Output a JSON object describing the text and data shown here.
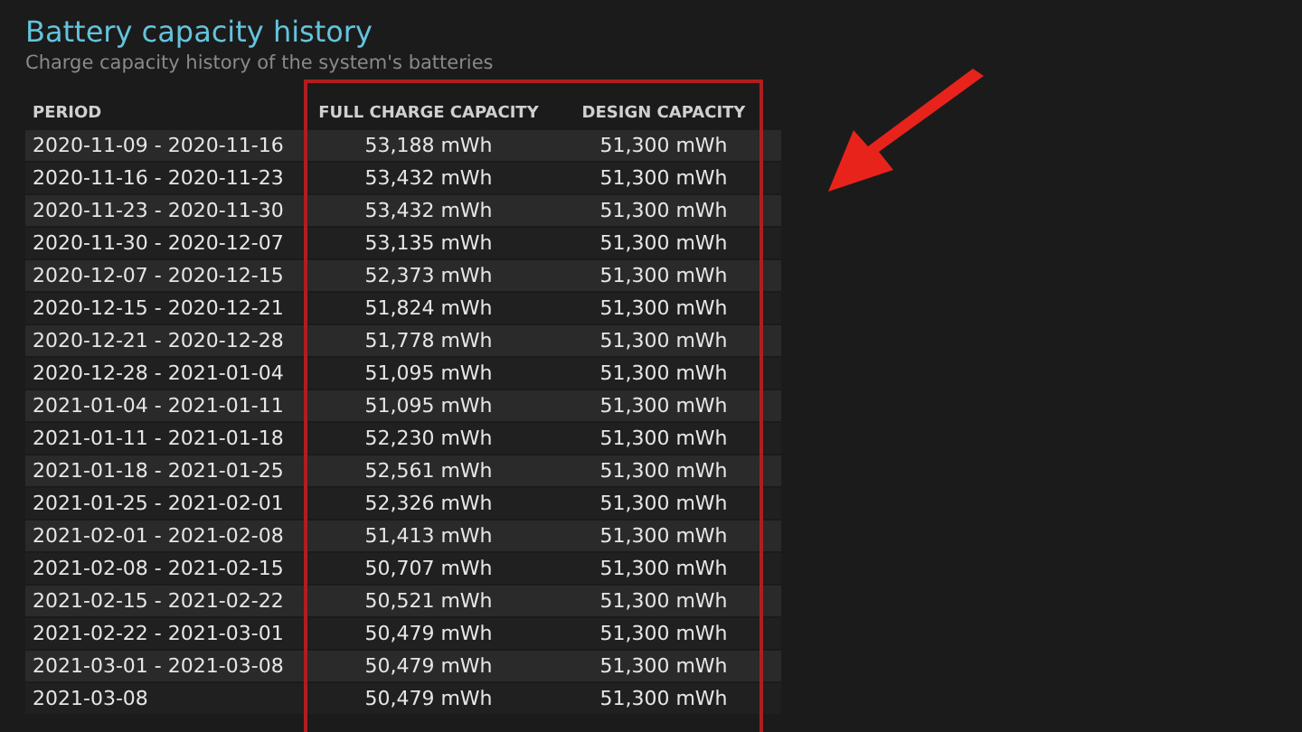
{
  "title": "Battery capacity history",
  "subtitle": "Charge capacity history of the system's batteries",
  "table": {
    "columns": [
      "PERIOD",
      "FULL CHARGE CAPACITY",
      "DESIGN CAPACITY"
    ],
    "rows": [
      [
        "2020-11-09 - 2020-11-16",
        "53,188 mWh",
        "51,300 mWh"
      ],
      [
        "2020-11-16 - 2020-11-23",
        "53,432 mWh",
        "51,300 mWh"
      ],
      [
        "2020-11-23 - 2020-11-30",
        "53,432 mWh",
        "51,300 mWh"
      ],
      [
        "2020-11-30 - 2020-12-07",
        "53,135 mWh",
        "51,300 mWh"
      ],
      [
        "2020-12-07 - 2020-12-15",
        "52,373 mWh",
        "51,300 mWh"
      ],
      [
        "2020-12-15 - 2020-12-21",
        "51,824 mWh",
        "51,300 mWh"
      ],
      [
        "2020-12-21 - 2020-12-28",
        "51,778 mWh",
        "51,300 mWh"
      ],
      [
        "2020-12-28 - 2021-01-04",
        "51,095 mWh",
        "51,300 mWh"
      ],
      [
        "2021-01-04 - 2021-01-11",
        "51,095 mWh",
        "51,300 mWh"
      ],
      [
        "2021-01-11 - 2021-01-18",
        "52,230 mWh",
        "51,300 mWh"
      ],
      [
        "2021-01-18 - 2021-01-25",
        "52,561 mWh",
        "51,300 mWh"
      ],
      [
        "2021-01-25 - 2021-02-01",
        "52,326 mWh",
        "51,300 mWh"
      ],
      [
        "2021-02-01 - 2021-02-08",
        "51,413 mWh",
        "51,300 mWh"
      ],
      [
        "2021-02-08 - 2021-02-15",
        "50,707 mWh",
        "51,300 mWh"
      ],
      [
        "2021-02-15 - 2021-02-22",
        "50,521 mWh",
        "51,300 mWh"
      ],
      [
        "2021-02-22 - 2021-03-01",
        "50,479 mWh",
        "51,300 mWh"
      ],
      [
        "2021-03-01 - 2021-03-08",
        "50,479 mWh",
        "51,300 mWh"
      ],
      [
        "2021-03-08",
        "50,479 mWh",
        "51,300 mWh"
      ]
    ]
  }
}
